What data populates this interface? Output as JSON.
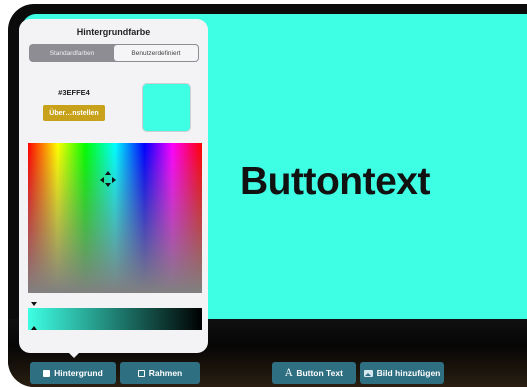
{
  "canvas": {
    "background_color": "#3effe4",
    "button_text": "Buttontext"
  },
  "popover": {
    "title": "Hintergrundfarbe",
    "tabs": [
      {
        "label": "Standardfarben",
        "active": false
      },
      {
        "label": "Benutzerdefiniert",
        "active": true
      }
    ],
    "hex_value": "#3EFFE4",
    "apply_label": "Über…nstellen",
    "preview_color": "#3effe4"
  },
  "toolbar": {
    "background_label": "Hintergrund",
    "border_label": "Rahmen",
    "button_text_label": "Button Text",
    "add_image_label": "Bild hinzufügen"
  },
  "colors": {
    "accent": "#3effe4",
    "apply_button": "#c8a21a",
    "toolbar_button": "#2e6f82"
  },
  "icons": [
    "filled-square-icon",
    "outline-square-icon",
    "text-A-icon",
    "image-icon",
    "picker-cursor-icon",
    "shade-slider-icon"
  ]
}
